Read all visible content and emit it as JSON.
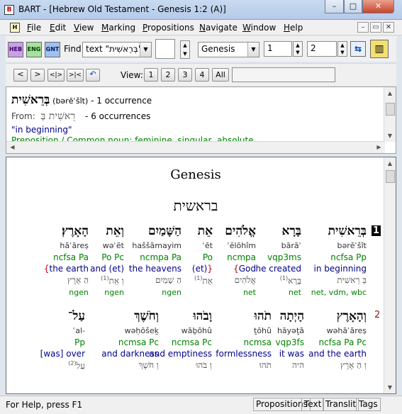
{
  "window": {
    "title": "BART - [Hebrew Old Testament - Genesis 1:2 (A)]",
    "controls": {
      "minimize": "–",
      "maximize": "□",
      "close": "✕"
    }
  },
  "menubar": {
    "items": [
      "File",
      "Edit",
      "View",
      "Marking",
      "Propositions",
      "Navigate",
      "Window",
      "Help"
    ],
    "mdi_controls": [
      "–",
      "▭",
      "✕"
    ]
  },
  "toolbar": {
    "icons": [
      "HEB",
      "ENG",
      "GNT"
    ],
    "find_label": "Find:",
    "find_value": "text \"בְּרֵאשִׁית\"",
    "book_value": "Genesis",
    "chapter_value": "1",
    "verse_value": "2",
    "view_label": "View:",
    "view_buttons": [
      "1",
      "2",
      "3",
      "4",
      "All"
    ],
    "nav_buttons": [
      "<",
      ">",
      "<|>",
      ">|<",
      "↶"
    ]
  },
  "info": {
    "headword": "בְּרֵאשִׁית",
    "headword_translit": "(bərēʾšît)",
    "occurrences": "- 1 occurrence",
    "from_label": "From:",
    "from_lexeme": "רֵאשִׁית בְּ",
    "from_occurrences": "- 6 occurrences",
    "gloss": "\"in beginning\"",
    "parsing": "Preposition / Common noun: feminine, singular, absolute"
  },
  "text": {
    "book_title": "Genesis",
    "book_title_hebrew": "בראשית",
    "verse1": {
      "number": "1",
      "words": [
        {
          "hebrew": "בְּרֵאשִׁית",
          "translit": "bərēʾšît",
          "pos": "ncfsa Pp",
          "gloss_pre": "",
          "gloss": "in beginning",
          "gloss_post": "",
          "lexeme": "בְּ רֵאשִׁית",
          "lex_sup": "",
          "source": "net, vdm, wbc"
        },
        {
          "hebrew": "בָּרָא",
          "translit": "bārāʾ",
          "pos": "vqp3ms",
          "gloss_pre": "",
          "gloss": "he created",
          "gloss_post": "",
          "lexeme": "בָּרָא",
          "lex_sup": "(1)",
          "source": "net"
        },
        {
          "hebrew": "אֱלֹהִים",
          "translit": "ʾĕlōhîm",
          "pos": "ncmpa",
          "gloss_pre": "{",
          "gloss": "God",
          "gloss_post": "",
          "lexeme": "אֱלֹהִים",
          "lex_sup": "",
          "source": "net"
        },
        {
          "hebrew": "אֵת",
          "translit": "ʾēt",
          "pos": "Po",
          "gloss_pre": "",
          "gloss": "(et)",
          "gloss_post": "}",
          "lexeme": "אֵת",
          "lex_sup": "(1)",
          "source": ""
        },
        {
          "hebrew": "הַשָּׁמַיִם",
          "translit": "haššāmayim",
          "pos": "ncmpa Pa",
          "gloss_pre": "",
          "gloss": "the heavens",
          "gloss_post": "",
          "lexeme": "הַ שָׁמַיִם",
          "lex_sup": "",
          "source": "ngen"
        },
        {
          "hebrew": "וְאֵת",
          "translit": "wəʾēt",
          "pos": "Po Pc",
          "gloss_pre": "",
          "gloss": "and (et)",
          "gloss_post": "",
          "lexeme": "וְ אֵת",
          "lex_sup": "(1)",
          "source": "ngen"
        },
        {
          "hebrew": "הָאָרֶץ׃",
          "translit": "hāʾāreṣ",
          "pos": "ncfsa Pa",
          "gloss_pre": "{",
          "gloss": "the earth",
          "gloss_post": "",
          "lexeme": "הַ אֶרֶץ",
          "lex_sup": "",
          "source": "ngen"
        }
      ]
    },
    "verse2": {
      "number": "2",
      "words": [
        {
          "hebrew": "וְהָאָרֶץ",
          "translit": "wəhāʾāreṣ",
          "pos": "ncfsa Pa Pc",
          "gloss_pre": "",
          "gloss": "and the earth",
          "gloss_post": "",
          "lexeme": "וְ הַ אֶרֶץ",
          "lex_sup": "",
          "source": ""
        },
        {
          "hebrew": "הָיְתָה",
          "translit": "hāyəṯā",
          "pos": "vqp3fs",
          "gloss_pre": "",
          "gloss": "it was",
          "gloss_post": "",
          "lexeme": "היה",
          "lex_sup": "",
          "source": ""
        },
        {
          "hebrew": "תֹהוּ",
          "translit": "ṯōhû",
          "pos": "ncmsa",
          "gloss_pre": "",
          "gloss": "formlessness",
          "gloss_post": "",
          "lexeme": "תֹהוּ",
          "lex_sup": "",
          "source": ""
        },
        {
          "hebrew": "וָבֹהוּ",
          "translit": "wāḇōhû",
          "pos": "ncmsa Pc",
          "gloss_pre": "",
          "gloss": "and emptiness",
          "gloss_post": "",
          "lexeme": "וְ בֹהוּ",
          "lex_sup": "",
          "source": ""
        },
        {
          "hebrew": "וְחֹשֶׁךְ",
          "translit": "wəḥōšeḵ",
          "pos": "ncmsa Pc",
          "gloss_pre": "",
          "gloss": "and darkness",
          "gloss_post": "",
          "lexeme": "וְ חֹשֶׁךְ",
          "lex_sup": "",
          "source": ""
        },
        {
          "hebrew": "עַל־",
          "translit": "ʿal-",
          "pos": "Pp",
          "gloss_pre": "",
          "gloss": "[was] over",
          "gloss_post": "",
          "lexeme": "עַל",
          "lex_sup": "(2)",
          "source": ""
        }
      ]
    }
  },
  "status": {
    "help_text": "For Help, press F1",
    "cells": [
      "Propositions",
      "Text",
      "Translit",
      "Tags"
    ]
  },
  "colors": {
    "pos_green": "#008000",
    "gloss_blue": "#00008b",
    "brace_red": "#c00000",
    "verse2_number": "#8b1a1a"
  }
}
